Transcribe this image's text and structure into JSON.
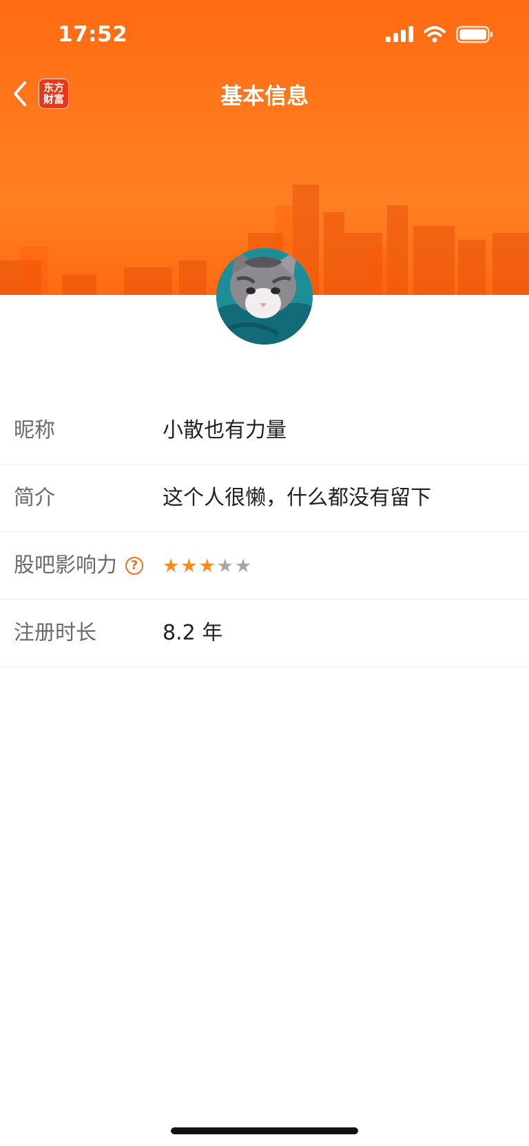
{
  "status_bar": {
    "time": "17:52"
  },
  "nav": {
    "title": "基本信息",
    "logo_line1": "东方",
    "logo_line2": "财富"
  },
  "profile": {
    "rows": [
      {
        "label": "昵称",
        "value": "小散也有力量"
      },
      {
        "label": "简介",
        "value": "这个人很懒，什么都没有留下"
      },
      {
        "label": "股吧影响力",
        "help": "?",
        "rating": 3,
        "rating_max": 5
      },
      {
        "label": "注册时长",
        "value": "8.2 年"
      }
    ]
  },
  "colors": {
    "accent": "#ff6a13",
    "star_active": "#ff8a1c",
    "star_inactive": "#a6a6a6"
  }
}
